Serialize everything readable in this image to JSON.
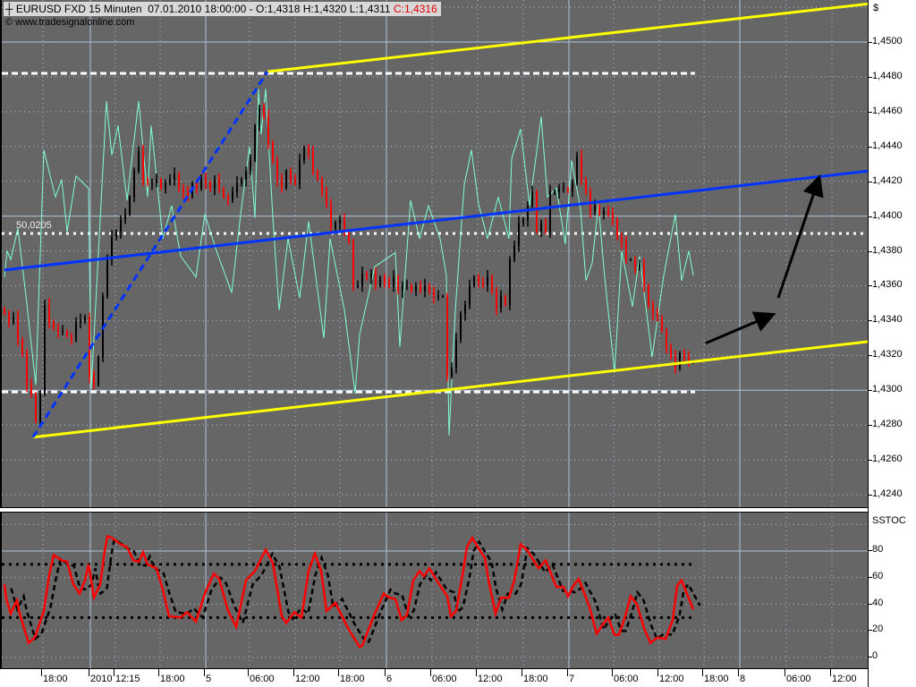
{
  "header": {
    "symbol": "EURUSD FXD 15 Minuten",
    "datetime": "07.01.2010 18:00:00",
    "ohl": "- O:1,4318 H:1,4320 L:1,4311",
    "close": "C:1,4316",
    "copyright": "© www.tradesignalonline.com",
    "crosshair_icon": "crosshair-icon"
  },
  "colors": {
    "background": "#666666",
    "bull": "#000000",
    "bear": "#ff0000",
    "overlay": "#7fffd4",
    "channel": "#ffff00",
    "trend": "#0033ff",
    "stoch_k": "#ff0000",
    "stoch_d": "#000000"
  },
  "chart_data": [
    {
      "type": "candlestick",
      "title": "EURUSD FXD 15 Minuten",
      "ylabel": "$",
      "ylim": [
        1.4232,
        1.4522
      ],
      "yticks": [
        "1,4240",
        "1,4260",
        "1,4280",
        "1,4300",
        "1,4320",
        "1,4340",
        "1,4360",
        "1,4380",
        "1,4400",
        "1,4420",
        "1,4440",
        "1,4460",
        "1,4480",
        "1,4500"
      ],
      "ytick_values": [
        1.424,
        1.426,
        1.428,
        1.43,
        1.432,
        1.434,
        1.436,
        1.438,
        1.44,
        1.442,
        1.444,
        1.446,
        1.448,
        1.45
      ],
      "closes": [
        1.4344,
        1.4339,
        1.4342,
        1.4329,
        1.4321,
        1.4303,
        1.4298,
        1.4282,
        1.4298,
        1.4349,
        1.4339,
        1.4336,
        1.4334,
        1.4334,
        1.4331,
        1.4329,
        1.4339,
        1.434,
        1.4342,
        1.4308,
        1.4303,
        1.4319,
        1.4354,
        1.4375,
        1.4388,
        1.4391,
        1.4398,
        1.4401,
        1.4411,
        1.4426,
        1.4437,
        1.4421,
        1.4419,
        1.4419,
        1.4421,
        1.4416,
        1.4419,
        1.4421,
        1.4424,
        1.4416,
        1.4414,
        1.4411,
        1.4419,
        1.4416,
        1.4421,
        1.4419,
        1.4416,
        1.4421,
        1.4416,
        1.4411,
        1.4409,
        1.4414,
        1.4419,
        1.4421,
        1.4426,
        1.4432,
        1.4452,
        1.4462,
        1.4457,
        1.4442,
        1.4432,
        1.4421,
        1.4416,
        1.4426,
        1.4421,
        1.4419,
        1.4432,
        1.4439,
        1.4437,
        1.4426,
        1.4421,
        1.4414,
        1.4406,
        1.4393,
        1.4396,
        1.4398,
        1.4391,
        1.4385,
        1.436,
        1.436,
        1.4367,
        1.4365,
        1.4367,
        1.436,
        1.4365,
        1.4362,
        1.436,
        1.4365,
        1.4357,
        1.436,
        1.436,
        1.4357,
        1.436,
        1.4357,
        1.436,
        1.4357,
        1.4354,
        1.4354,
        1.4354,
        1.4308,
        1.4313,
        1.4329,
        1.4344,
        1.4349,
        1.436,
        1.4365,
        1.4362,
        1.436,
        1.4365,
        1.4357,
        1.4347,
        1.4354,
        1.4349,
        1.4375,
        1.4383,
        1.4396,
        1.4398,
        1.4406,
        1.4414,
        1.4391,
        1.4396,
        1.4391,
        1.4414,
        1.4414,
        1.4416,
        1.4416,
        1.4414,
        1.4419,
        1.4434,
        1.4421,
        1.4414,
        1.4403,
        1.4406,
        1.4401,
        1.4403,
        1.4401,
        1.4398,
        1.4388,
        1.4385,
        1.4375,
        1.4375,
        1.437,
        1.4372,
        1.436,
        1.4349,
        1.4344,
        1.4342,
        1.4334,
        1.4324,
        1.4319,
        1.4313,
        1.4321,
        1.4319,
        1.4316,
        1.4316
      ],
      "overlay_series": [
        [
          0,
          1.4365
        ],
        [
          0.6,
          1.438
        ],
        [
          1.4,
          1.4375
        ],
        [
          3,
          1.4393
        ],
        [
          4.8,
          1.4354
        ],
        [
          7,
          1.4303
        ],
        [
          8.8,
          1.4438
        ],
        [
          11.4,
          1.4411
        ],
        [
          12.8,
          1.4421
        ],
        [
          14,
          1.4391
        ],
        [
          16,
          1.4423
        ],
        [
          18.8,
          1.4416
        ],
        [
          19.4,
          1.4301
        ],
        [
          22.8,
          1.4466
        ],
        [
          24,
          1.4435
        ],
        [
          25.4,
          1.4452
        ],
        [
          27.4,
          1.4409
        ],
        [
          30,
          1.4466
        ],
        [
          32,
          1.4411
        ],
        [
          32.8,
          1.4452
        ],
        [
          35.4,
          1.4387
        ],
        [
          37.4,
          1.4406
        ],
        [
          39.4,
          1.4377
        ],
        [
          42.8,
          1.4365
        ],
        [
          44.8,
          1.4401
        ],
        [
          47.4,
          1.438
        ],
        [
          50.8,
          1.4356
        ],
        [
          52.8,
          1.4401
        ],
        [
          54.8,
          1.444
        ],
        [
          56,
          1.4399
        ],
        [
          56.8,
          1.4473
        ],
        [
          57.4,
          1.4447
        ],
        [
          58.4,
          1.4473
        ],
        [
          60,
          1.4399
        ],
        [
          61.4,
          1.4346
        ],
        [
          63.4,
          1.4387
        ],
        [
          66,
          1.4353
        ],
        [
          68,
          1.4397
        ],
        [
          71.4,
          1.433
        ],
        [
          72.8,
          1.4387
        ],
        [
          76,
          1.4346
        ],
        [
          78.4,
          1.4298
        ],
        [
          79.4,
          1.4332
        ],
        [
          82.8,
          1.4371
        ],
        [
          87.4,
          1.4379
        ],
        [
          88.4,
          1.4325
        ],
        [
          90.8,
          1.4409
        ],
        [
          92.8,
          1.4387
        ],
        [
          94.8,
          1.4406
        ],
        [
          97.4,
          1.4387
        ],
        [
          98.8,
          1.4366
        ],
        [
          99.4,
          1.4274
        ],
        [
          100.8,
          1.4346
        ],
        [
          102.8,
          1.4418
        ],
        [
          104.4,
          1.4438
        ],
        [
          106,
          1.4407
        ],
        [
          108,
          1.4387
        ],
        [
          110.4,
          1.4411
        ],
        [
          112.8,
          1.4387
        ],
        [
          113.4,
          1.4433
        ],
        [
          115.4,
          1.445
        ],
        [
          117.4,
          1.4406
        ],
        [
          120,
          1.4457
        ],
        [
          121.4,
          1.4411
        ],
        [
          123.4,
          1.4416
        ],
        [
          125.4,
          1.4384
        ],
        [
          126.8,
          1.4432
        ],
        [
          128.8,
          1.4404
        ],
        [
          130,
          1.4363
        ],
        [
          131.4,
          1.4373
        ],
        [
          132.8,
          1.4407
        ],
        [
          134,
          1.437
        ],
        [
          136.4,
          1.431
        ],
        [
          138,
          1.438
        ],
        [
          140.4,
          1.4348
        ],
        [
          142,
          1.4377
        ],
        [
          144.8,
          1.4319
        ],
        [
          147.4,
          1.4366
        ],
        [
          150,
          1.4401
        ],
        [
          151.4,
          1.4363
        ],
        [
          153,
          1.438
        ],
        [
          154,
          1.4366
        ]
      ],
      "drawings": {
        "channel_upper": [
          [
            58.8,
            1.4483
          ],
          [
            193.4,
            1.4522
          ]
        ],
        "channel_lower": [
          [
            6.4,
            1.4273
          ],
          [
            193.4,
            1.4328
          ]
        ],
        "trend_blue": [
          [
            0,
            1.4369
          ],
          [
            193.4,
            1.4426
          ]
        ],
        "fib_dashed": [
          [
            6.4,
            1.4273
          ],
          [
            58.8,
            1.4483
          ]
        ],
        "level_high": {
          "price": 1.4482,
          "to_bar": 154.4
        },
        "level_low": {
          "price": 1.4299,
          "to_bar": 154.4
        },
        "level_mid": {
          "price": 1.439,
          "label": "50,0205"
        },
        "arrows": [
          [
            [
              156.8,
              1.4327
            ],
            [
              171.4,
              1.4343
            ]
          ],
          [
            [
              173,
              1.4353
            ],
            [
              182,
              1.4421
            ]
          ]
        ]
      }
    },
    {
      "type": "line",
      "title": "SSTOC",
      "ylim": [
        -5,
        105
      ],
      "yticks": [
        "0",
        "20",
        "40",
        "60",
        "80"
      ],
      "ytick_values": [
        0,
        20,
        40,
        60,
        80
      ],
      "levels": [
        70,
        30
      ],
      "d_lag_bars": 1.5,
      "k_series": [
        [
          0,
          55
        ],
        [
          0.4,
          44
        ],
        [
          1.4,
          33
        ],
        [
          2.8,
          43
        ],
        [
          3.4,
          33
        ],
        [
          5.4,
          11
        ],
        [
          6.8,
          15
        ],
        [
          8.8,
          35
        ],
        [
          10,
          62
        ],
        [
          11,
          77
        ],
        [
          12.8,
          73
        ],
        [
          14,
          72
        ],
        [
          15.4,
          55
        ],
        [
          16.8,
          48
        ],
        [
          18,
          58
        ],
        [
          18.8,
          70
        ],
        [
          19.4,
          58
        ],
        [
          20,
          45
        ],
        [
          21.4,
          55
        ],
        [
          22.4,
          80
        ],
        [
          23,
          91
        ],
        [
          24,
          90
        ],
        [
          26,
          85
        ],
        [
          27.4,
          83
        ],
        [
          28.8,
          73
        ],
        [
          30,
          72
        ],
        [
          31,
          79
        ],
        [
          32,
          70
        ],
        [
          34,
          67
        ],
        [
          35.4,
          51
        ],
        [
          36.8,
          31
        ],
        [
          39.4,
          30
        ],
        [
          40.8,
          34
        ],
        [
          42.8,
          27
        ],
        [
          44.8,
          48
        ],
        [
          46.8,
          63
        ],
        [
          48,
          59
        ],
        [
          50,
          35
        ],
        [
          51.8,
          23
        ],
        [
          54,
          58
        ],
        [
          56,
          65
        ],
        [
          58.4,
          81
        ],
        [
          60,
          71
        ],
        [
          62,
          31
        ],
        [
          63,
          26
        ],
        [
          64.8,
          34
        ],
        [
          66.4,
          30
        ],
        [
          68,
          65
        ],
        [
          69.4,
          78
        ],
        [
          70.8,
          65
        ],
        [
          72,
          35
        ],
        [
          74,
          41
        ],
        [
          76.8,
          22
        ],
        [
          79.4,
          8
        ],
        [
          80,
          9
        ],
        [
          82.8,
          33
        ],
        [
          84.8,
          48
        ],
        [
          86,
          45
        ],
        [
          87.4,
          44
        ],
        [
          88.8,
          28
        ],
        [
          90,
          32
        ],
        [
          91.4,
          58
        ],
        [
          92.8,
          65
        ],
        [
          93.8,
          61
        ],
        [
          95,
          67
        ],
        [
          97.4,
          54
        ],
        [
          99,
          46
        ],
        [
          99.8,
          31
        ],
        [
          101,
          35
        ],
        [
          102.4,
          62
        ],
        [
          103.4,
          83
        ],
        [
          104.6,
          90
        ],
        [
          106,
          82
        ],
        [
          107.4,
          75
        ],
        [
          108.4,
          55
        ],
        [
          109.8,
          33
        ],
        [
          111,
          45
        ],
        [
          112.8,
          45
        ],
        [
          114,
          58
        ],
        [
          115.4,
          85
        ],
        [
          116.8,
          81
        ],
        [
          119.4,
          67
        ],
        [
          121,
          73
        ],
        [
          123.4,
          53
        ],
        [
          125,
          53
        ],
        [
          126,
          46
        ],
        [
          127.4,
          55
        ],
        [
          128.4,
          59
        ],
        [
          130.8,
          38
        ],
        [
          132.4,
          18
        ],
        [
          133.8,
          25
        ],
        [
          135,
          30
        ],
        [
          136.4,
          17
        ],
        [
          137.4,
          17
        ],
        [
          138.8,
          31
        ],
        [
          140,
          46
        ],
        [
          141.4,
          40
        ],
        [
          143,
          22
        ],
        [
          144.4,
          11
        ],
        [
          146,
          15
        ],
        [
          147.8,
          14
        ],
        [
          149.4,
          28
        ],
        [
          150.4,
          54
        ],
        [
          151.4,
          58
        ],
        [
          154,
          36
        ]
      ]
    }
  ],
  "x_axis": {
    "ticks": [
      {
        "bar": 8.6,
        "label": "18:00",
        "day": false
      },
      {
        "bar": 19.2,
        "label": "2010",
        "day": true
      },
      {
        "bar": 24.8,
        "label": "12:15",
        "day": false
      },
      {
        "bar": 34.8,
        "label": "18:00",
        "day": false
      },
      {
        "bar": 45,
        "label": "5",
        "day": true
      },
      {
        "bar": 54.8,
        "label": "06:00",
        "day": false
      },
      {
        "bar": 65,
        "label": "12:00",
        "day": false
      },
      {
        "bar": 75,
        "label": "18:00",
        "day": false
      },
      {
        "bar": 85.4,
        "label": "6",
        "day": true
      },
      {
        "bar": 95.6,
        "label": "06:00",
        "day": false
      },
      {
        "bar": 105.8,
        "label": "12:00",
        "day": false
      },
      {
        "bar": 116,
        "label": "18:00",
        "day": false
      },
      {
        "bar": 126.2,
        "label": "7",
        "day": true
      },
      {
        "bar": 136.2,
        "label": "06:00",
        "day": false
      },
      {
        "bar": 146.4,
        "label": "12:00",
        "day": false
      },
      {
        "bar": 156.4,
        "label": "18:00",
        "day": false
      },
      {
        "bar": 164.4,
        "label": "8",
        "day": true
      },
      {
        "bar": 174.8,
        "label": "06:00",
        "day": false
      },
      {
        "bar": 185,
        "label": "12:00",
        "day": false
      }
    ]
  },
  "right_axis": {
    "currency": "$",
    "stoch_title": "SSTOC"
  }
}
